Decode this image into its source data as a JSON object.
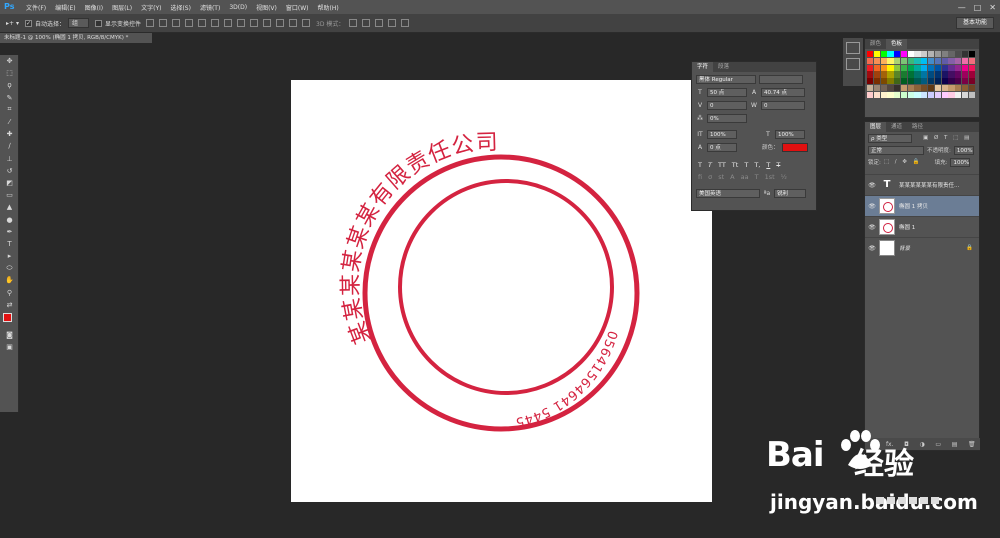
{
  "app": {
    "logo": "Ps"
  },
  "menu": [
    "文件(F)",
    "编辑(E)",
    "图像(I)",
    "图层(L)",
    "文字(Y)",
    "选择(S)",
    "滤镜(T)",
    "3D(D)",
    "视图(V)",
    "窗口(W)",
    "帮助(H)"
  ],
  "window_controls": [
    "—",
    "□",
    "✕"
  ],
  "options": {
    "auto_select_label": "自动选择：",
    "auto_select_value": "组",
    "show_transform_label": "显示变换控件",
    "mode_3d_label": "3D 模式：",
    "workspace": "基本功能"
  },
  "document_tab": "未标题-1 @ 100% (椭圆 1 拷贝, RGB/8/CMYK) *",
  "seal": {
    "outer_text": "某某某某某某有限责任公司",
    "inner_text": "05641564641 5445",
    "color": "#d42340"
  },
  "character_panel": {
    "tabs": [
      "字符",
      "段落"
    ],
    "font_family": "黑体",
    "font_style": "Regular",
    "font_size": "50 点",
    "leading": "40.74 点",
    "kerning": "0",
    "tracking": "0",
    "scale_pct": "0%",
    "vertical_scale": "100%",
    "horizontal_scale": "100%",
    "baseline_shift": "0 点",
    "color_label": "颜色：",
    "text_color": "#e01010",
    "glyph_buttons": [
      "T",
      "T",
      "TT",
      "Tt",
      "T",
      "T,",
      "T",
      "T"
    ],
    "language": "美国英语",
    "antialias": "锐利"
  },
  "swatch_panel": {
    "tabs": [
      "颜色",
      "色板"
    ]
  },
  "layers_panel": {
    "tabs": [
      "图层",
      "通道",
      "路径"
    ],
    "filter_label": "ρ 类型",
    "blend_mode": "正常",
    "opacity_label": "不透明度:",
    "opacity": "100%",
    "lock_label": "锁定:",
    "fill_label": "填充:",
    "fill": "100%",
    "layers": [
      {
        "name": "某某某某某某有限责任...",
        "type": "text",
        "selected": false
      },
      {
        "name": "椭圆 1 拷贝",
        "type": "shape",
        "selected": true
      },
      {
        "name": "椭圆 1",
        "type": "shape",
        "selected": false
      },
      {
        "name": "背景",
        "type": "background",
        "selected": false
      }
    ],
    "footer_icons": [
      "∞",
      "fx.",
      "◘",
      "◑",
      "▭",
      "▤",
      "🗑"
    ]
  },
  "watermark": {
    "brand": "Bai",
    "brand2": "经验",
    "url": "jingyan.baidu.com"
  }
}
